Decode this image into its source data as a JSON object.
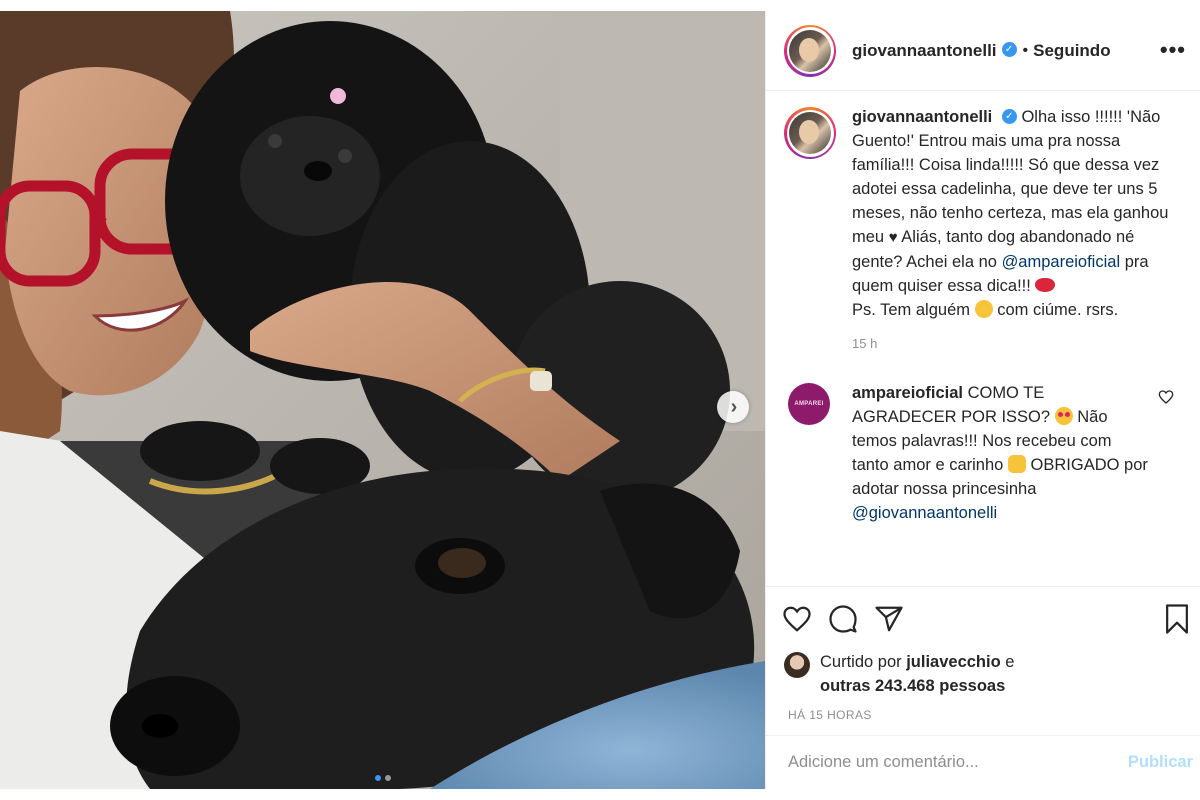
{
  "post": {
    "header": {
      "username": "giovannaantonelli",
      "verified_icon": "verified-badge-icon",
      "separator": "•",
      "follow_status": "Seguindo",
      "more": "•••"
    },
    "caption": {
      "username": "giovannaantonelli",
      "text_1": "Olha isso !!!!!! 'Não Guento!' Entrou mais uma pra nossa família!!! Coisa linda!!!!! Só que dessa vez adotei essa cadelinha, que deve ter uns 5 meses, não tenho certeza, mas ela ganhou meu",
      "heart": "♥",
      "text_2": "Aliás, tanto dog abandonado né gente? Achei ela no",
      "mention": "@amparei oficial",
      "text_3": "pra quem quiser essa dica!!!",
      "text_4": "Ps. Tem alguém",
      "text_5": "com ciúme. rsrs.",
      "time": "15 h"
    },
    "comment": {
      "avatar_text": "AMPAREI",
      "username": "ampareioficial",
      "text_1": "COMO TE AGRADECER POR ISSO?",
      "text_2": "Não temos palavras!!! Nos recebeu com tanto amor e carinho",
      "text_3": "OBRIGADO por adotar nossa princesinha",
      "mention": "@giovannaantonelli"
    },
    "actions": {
      "like_icon": "heart-outline-icon",
      "comment_icon": "comment-bubble-icon",
      "share_icon": "paper-plane-icon",
      "save_icon": "bookmark-icon"
    },
    "likes": {
      "prefix": "Curtido por",
      "liker": "juliavecchio",
      "middle": "e",
      "others": "outras 243.468 pessoas"
    },
    "ago": "HÁ 15 HORAS",
    "add_comment": {
      "placeholder": "Adicione um comentário...",
      "publish": "Publicar"
    }
  },
  "carousel": {
    "next_icon": "chevron-right-icon",
    "slides_total": 2,
    "current_slide": 1
  },
  "colors": {
    "accent_blue": "#3897f0",
    "mention": "#00376b",
    "publish_disabled": "#b2dffc",
    "ampare_brand": "#8e1a6c"
  }
}
